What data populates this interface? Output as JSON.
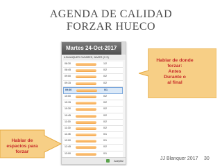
{
  "slide": {
    "title_line1": "AGENDA DE CALIDAD",
    "title_line2": "FORZAR HUECO",
    "callout_right_lines": [
      "Hablar de donde",
      "forzar:",
      "Antes",
      "Durante o",
      "al final"
    ],
    "callout_left_lines": [
      "Hablar de",
      "espacios para",
      "forzar"
    ],
    "author": "JJ Blanquer 2017",
    "page": "30"
  },
  "app": {
    "header_title": "Martes 24-Oct-2017",
    "subtitle": "A BLANQUER CASARES, JAVIER (C.S)",
    "footer_button": "Aceptar",
    "rows": [
      {
        "time": "08:30",
        "count": "1/2",
        "highlight": false
      },
      {
        "time": "08:45",
        "count": "0/2",
        "highlight": false
      },
      {
        "time": "09:00",
        "count": "0/2",
        "highlight": false
      },
      {
        "time": "09:15",
        "count": "0/2",
        "highlight": false
      },
      {
        "time": "09:30",
        "count": "0/1",
        "highlight": true
      },
      {
        "time": "10:00",
        "count": "0/2",
        "highlight": false
      },
      {
        "time": "10:15",
        "count": "0/2",
        "highlight": false
      },
      {
        "time": "10:30",
        "count": "0/2",
        "highlight": false
      },
      {
        "time": "10:45",
        "count": "0/2",
        "highlight": false
      },
      {
        "time": "11:00",
        "count": "0/2",
        "highlight": false
      },
      {
        "time": "11:30",
        "count": "0/2",
        "highlight": false
      },
      {
        "time": "11:45",
        "count": "0/1",
        "highlight": false
      },
      {
        "time": "12:00",
        "count": "0/1",
        "highlight": false
      },
      {
        "time": "12:45",
        "count": "0/2",
        "highlight": false
      },
      {
        "time": "13:00",
        "count": "0/1",
        "highlight": false
      }
    ]
  },
  "colors": {
    "callout_fill": "#f7cf86",
    "callout_stroke": "#e6a93d",
    "callout_text": "#c62828"
  }
}
